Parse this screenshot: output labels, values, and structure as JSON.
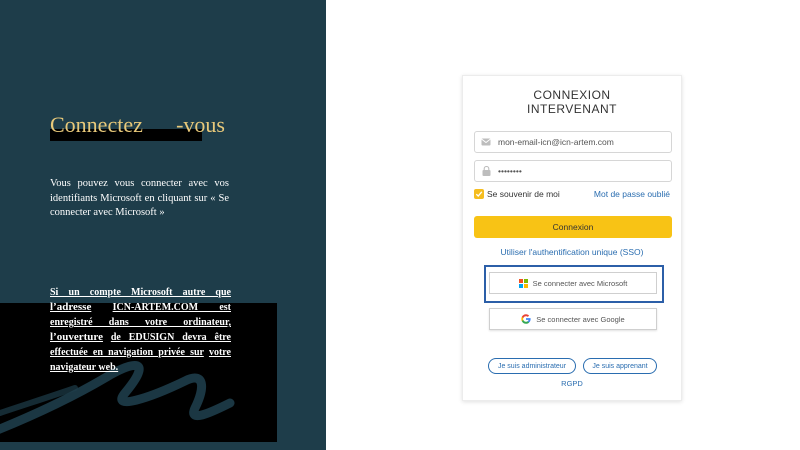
{
  "left": {
    "title_part1": "Connectez",
    "title_part2": "-vous",
    "intro": "Vous pouvez vous connecter avec vos identifiants Microsoft en cliquant sur « Se connecter avec Microsoft »",
    "warning": {
      "line1": "Si un compte Microsoft autre que",
      "line2a": "l’adresse",
      "line2b": "ICN-ARTEM.COM est",
      "line3": "enregistré dans votre ordinateur,",
      "line4a": "l’ouverture",
      "line4b": "de EDUSIGN devra être",
      "line5": "effectuée en navigation privée sur",
      "line6": "votre navigateur web."
    }
  },
  "login": {
    "title_line1": "CONNEXION",
    "title_line2": "INTERVENANT",
    "email_value": "mon-email-icn@icn-artem.com",
    "password_value": "••••••••",
    "remember_label": "Se souvenir de moi",
    "forgot_label": "Mot de passe oublié",
    "submit_label": "Connexion",
    "sso_label": "Utiliser l'authentification unique (SSO)",
    "microsoft_label": "Se connecter avec Microsoft",
    "google_label": "Se connecter avec Google",
    "admin_label": "Je suis administrateur",
    "learner_label": "Je suis apprenant",
    "rgpd_label": "RGPD"
  },
  "colors": {
    "left_background": "#1e3d4a",
    "title_gold": "#e8c97a",
    "accent_yellow": "#f8c315",
    "link_blue": "#2a6db0",
    "highlight_outline": "#2c5fa8"
  },
  "icons": {
    "email": "envelope-icon",
    "password": "lock-icon",
    "remember": "checkbox-checked-icon",
    "microsoft": "microsoft-logo-icon",
    "google": "google-logo-icon"
  }
}
